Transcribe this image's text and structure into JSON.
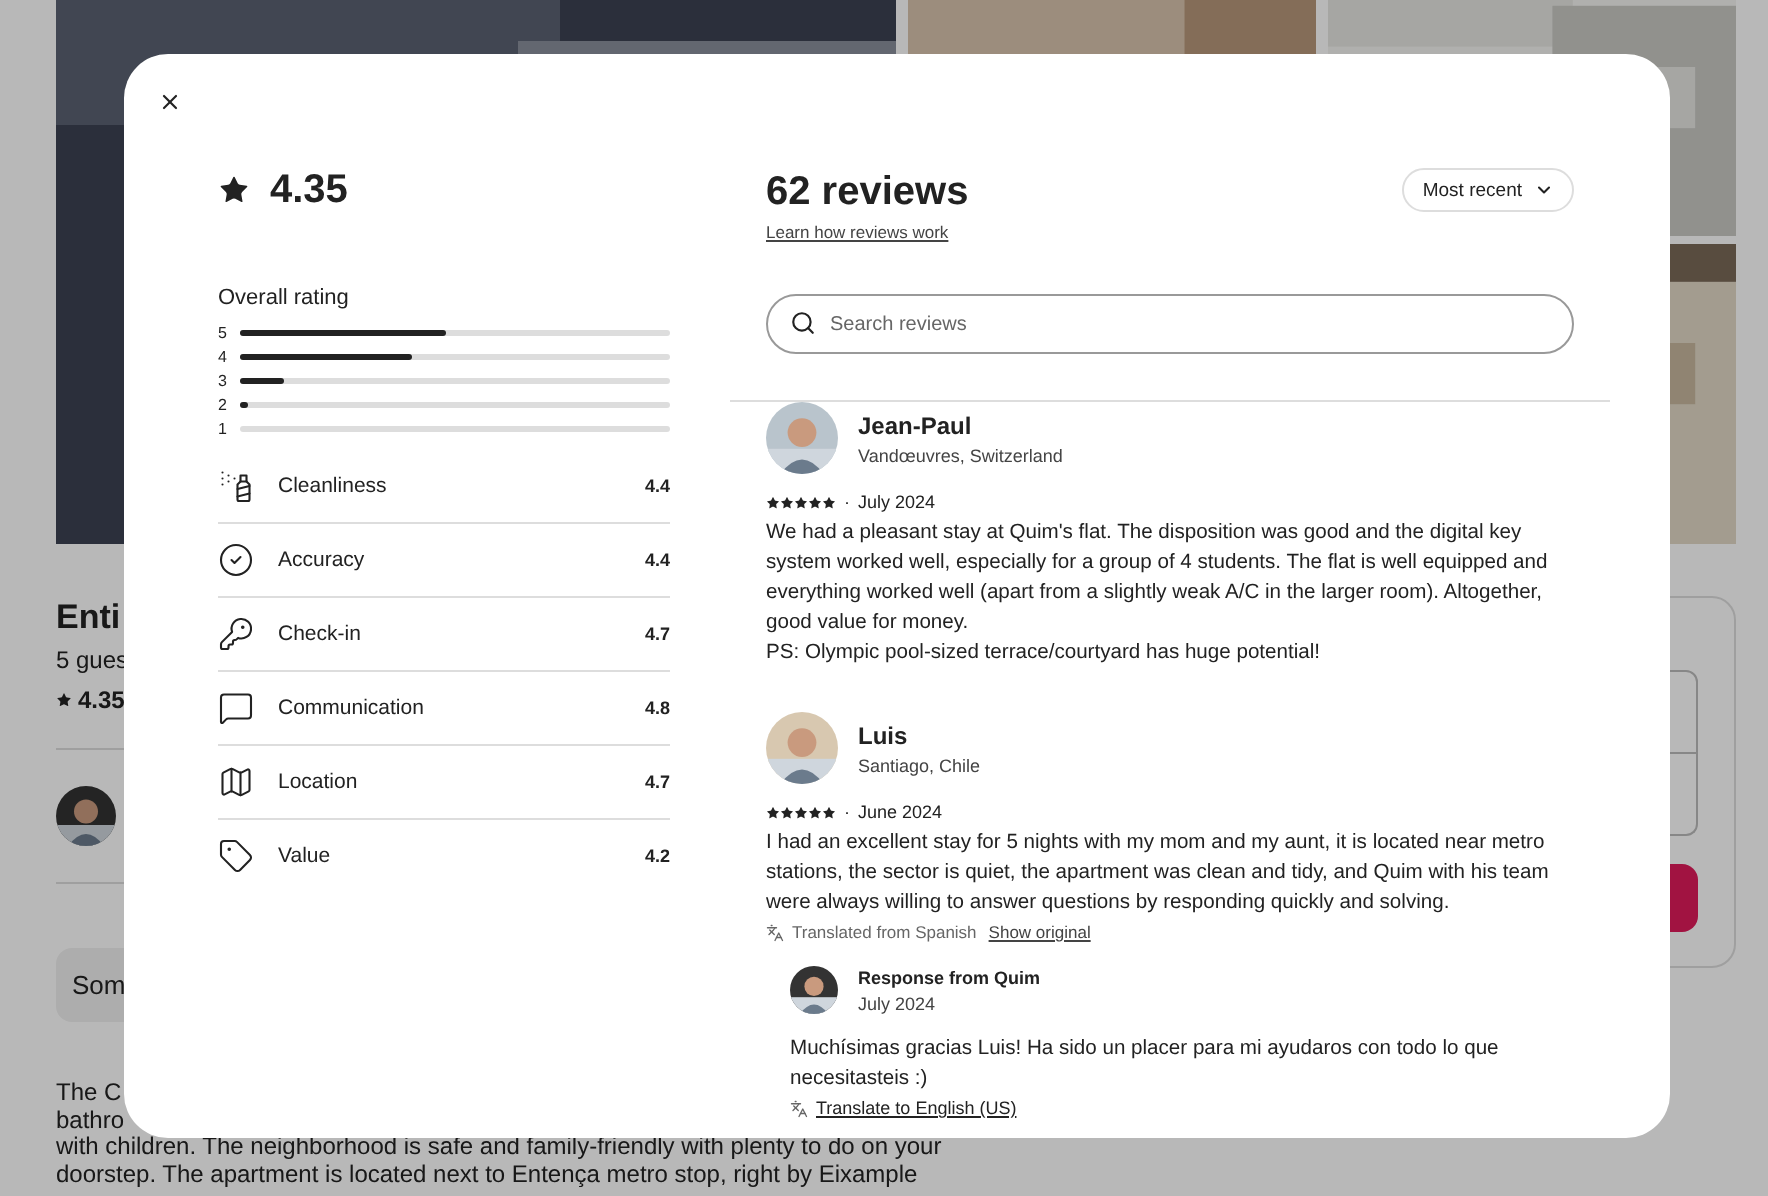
{
  "listing": {
    "title": "Enti",
    "details": "5 gues",
    "rating": "4.35",
    "notice": "Som",
    "description": [
      "The C",
      "bathro",
      "with children. The neighborhood is safe and family-friendly with plenty to do on your",
      "doorstep. The apartment is located next to Entença metro stop, right by Eixample"
    ]
  },
  "reviews_modal": {
    "rating": "4.35",
    "overall_label": "Overall rating",
    "distribution": [
      {
        "label": "5",
        "level": 0.48
      },
      {
        "label": "4",
        "level": 0.4
      },
      {
        "label": "3",
        "level": 0.1
      },
      {
        "label": "2",
        "level": 0.02
      },
      {
        "label": "1"
      }
    ],
    "categories": [
      {
        "kind": "cleanliness",
        "label": "Cleanliness",
        "score": "4.4"
      },
      {
        "kind": "accuracy",
        "label": "Accuracy",
        "score": "4.4"
      },
      {
        "kind": "checkin",
        "label": "Check-in",
        "score": "4.7"
      },
      {
        "kind": "communication",
        "label": "Communication",
        "score": "4.8"
      },
      {
        "kind": "location",
        "label": "Location",
        "score": "4.7"
      },
      {
        "kind": "value",
        "label": "Value",
        "score": "4.2"
      }
    ],
    "count_title": "62 reviews",
    "learn_link": "Learn how reviews work",
    "sort": "Most recent",
    "search": {
      "placeholder": "Search reviews"
    },
    "reviews": [
      {
        "name": "Jean-Paul",
        "location": "Vandœuvres, Switzerland",
        "stars": 5,
        "separator": "·",
        "date": "July 2024",
        "body": [
          "We had a pleasant stay at Quim's flat. The disposition was good and the digital key system worked well, especially for a group of 4 students. The flat is well equipped and everything worked well (apart from a slightly weak A/C in the larger room). Altogether, good value for money.",
          "PS: Olympic pool-sized terrace/courtyard has huge potential!"
        ]
      },
      {
        "name": "Luis",
        "location": "Santiago, Chile",
        "stars": 5,
        "separator": "·",
        "date": "June 2024",
        "body": [
          "I had an excellent stay for 5 nights with my mom and my aunt, it is located near metro stations, the sector is quiet, the apartment was clean and tidy, and Quim with his team were always willing to answer questions by responding quickly and solving."
        ],
        "translation": {
          "note": "Translated from Spanish",
          "link": "Show original"
        },
        "response": {
          "title": "Response from Quim",
          "date": "July 2024",
          "body": "Muchísimas gracias Luis! Ha sido un placer para mi ayudaros con todo lo que necesitasteis :)",
          "link": "Translate to English (US)"
        }
      }
    ]
  }
}
